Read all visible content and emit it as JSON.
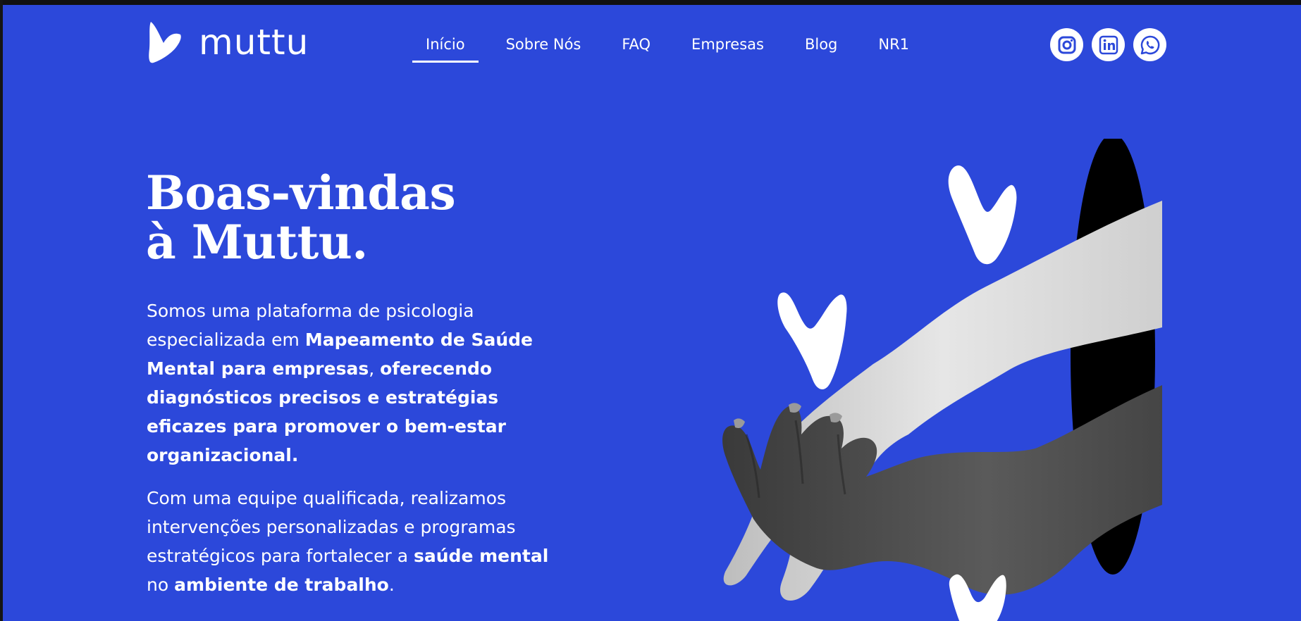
{
  "brand": {
    "name": "muttu"
  },
  "nav": {
    "items": [
      {
        "label": "Início",
        "active": true
      },
      {
        "label": "Sobre Nós",
        "active": false
      },
      {
        "label": "FAQ",
        "active": false
      },
      {
        "label": "Empresas",
        "active": false
      },
      {
        "label": "Blog",
        "active": false
      },
      {
        "label": "NR1",
        "active": false
      }
    ]
  },
  "socials": [
    {
      "icon": "instagram-icon"
    },
    {
      "icon": "linkedin-icon"
    },
    {
      "icon": "whatsapp-icon"
    }
  ],
  "hero": {
    "title_line1": "Boas-vindas",
    "title_line2": "à Muttu.",
    "p1": {
      "t1": "Somos uma plataforma de psicologia especializada em ",
      "b1": "Mapeamento de Saúde Mental para empresas",
      "t2": ", ",
      "b2": "oferecendo diagnósticos precisos e estratégias eficazes para promover o bem-estar organizacional."
    },
    "p2": {
      "t1": "Com uma equipe qualificada, realizamos intervenções personalizadas e programas estratégicos para fortalecer a ",
      "b1": "saúde mental",
      "t2": " no ",
      "b2": "ambiente de trabalho",
      "t3": "."
    }
  },
  "colors": {
    "background": "#2c48da",
    "text": "#ffffff",
    "hole": "#000000"
  }
}
